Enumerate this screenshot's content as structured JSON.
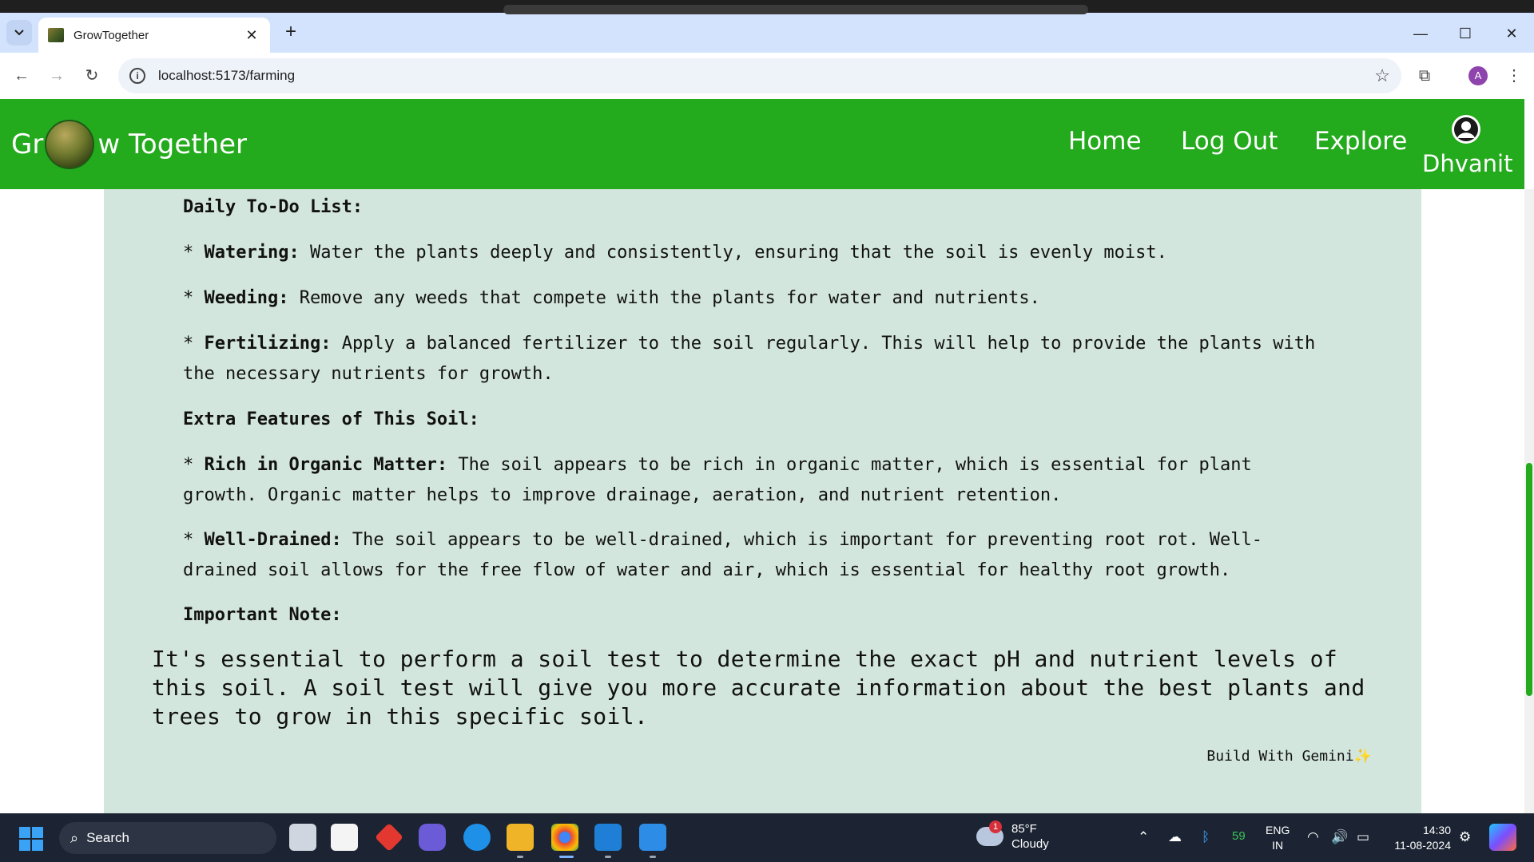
{
  "browser": {
    "tab_title": "GrowTogether",
    "tab_close": "✕",
    "new_tab": "+",
    "url": "localhost:5173/farming",
    "profile_initial": "A",
    "window_controls": [
      "—",
      "☐",
      "✕"
    ]
  },
  "header": {
    "brand_left": "Gr",
    "brand_right": "w Together",
    "nav": [
      "Home",
      "Log Out",
      "Explore"
    ],
    "user_name": "Dhvanit",
    "color": "#24aa1d"
  },
  "content": {
    "todo_heading": "Daily To-Do List:",
    "todo": [
      {
        "bullet": "* ",
        "label": "Watering:",
        "text": " Water the plants deeply and consistently, ensuring that the soil is evenly moist."
      },
      {
        "bullet": "* ",
        "label": "Weeding:",
        "text": " Remove any weeds that compete with the plants for water and nutrients."
      },
      {
        "bullet": "* ",
        "label": "Fertilizing:",
        "text": " Apply a balanced fertilizer to the soil regularly. This will help to provide the plants with",
        "text2": "the necessary nutrients for growth."
      }
    ],
    "extra_heading": "Extra Features of This Soil:",
    "extra": [
      {
        "bullet": "* ",
        "label": "Rich in Organic Matter:",
        "text": " The soil appears to be rich in organic matter, which is essential for plant",
        "text2": "growth. Organic matter helps to improve drainage, aeration, and nutrient retention."
      },
      {
        "bullet": "* ",
        "label": "Well-Drained:",
        "text": " The soil appears to be well-drained, which is important for preventing root rot. Well-",
        "text2": "drained soil allows for the free flow of water and air, which is essential for healthy root growth."
      }
    ],
    "note_heading": "Important Note:",
    "note": "It's essential to perform a soil test to determine the exact pH and nutrient levels of this soil. A soil test will give you more accurate information about the best plants and trees to grow in this specific soil.",
    "footer": "Build With Gemini✨",
    "card_color": "#d3e6dd"
  },
  "taskbar": {
    "search_label": "Search",
    "weather_temp": "85°F",
    "weather_desc": "Cloudy",
    "weather_badge": "1",
    "battery_num": "59",
    "lang_1": "ENG",
    "lang_2": "IN",
    "time": "14:30",
    "date": "11-08-2024"
  }
}
